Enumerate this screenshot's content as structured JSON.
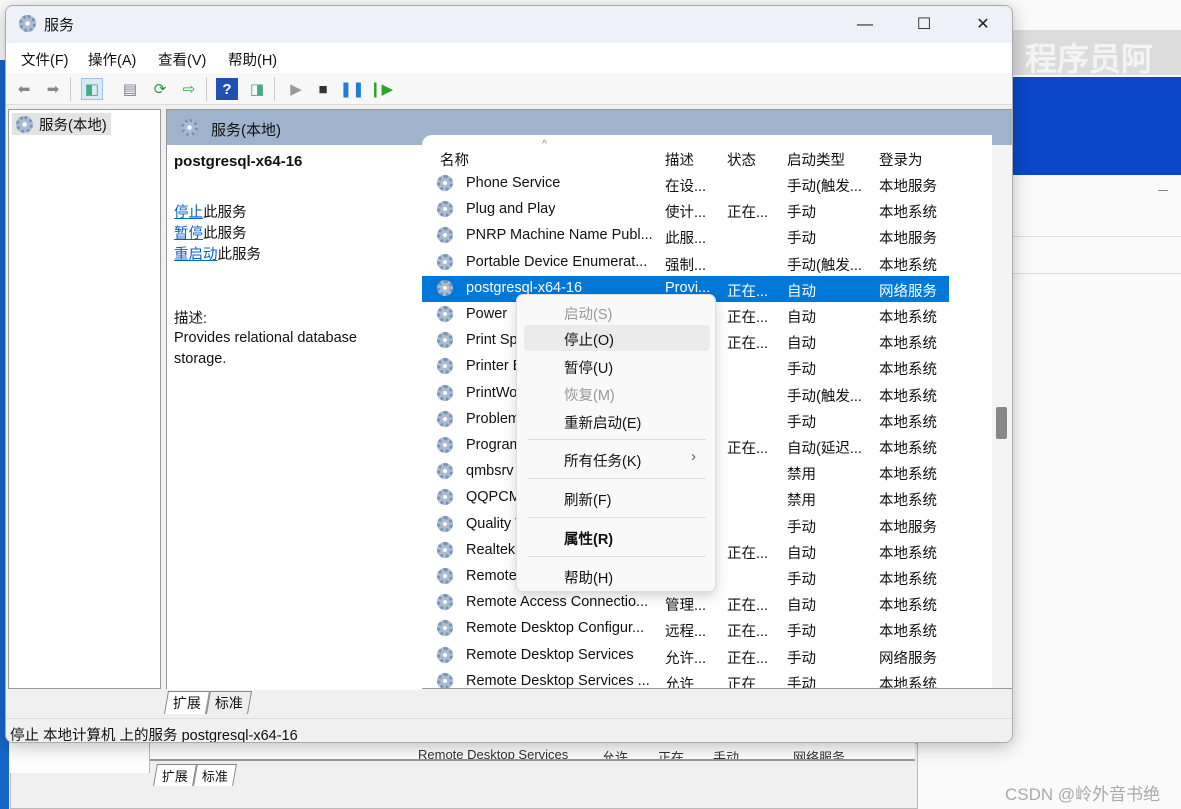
{
  "window": {
    "title": "服务",
    "minimize": "—",
    "maximize": "☐",
    "close": "✕"
  },
  "menubar": [
    "文件(F)",
    "操作(A)",
    "查看(V)",
    "帮助(H)"
  ],
  "toolbar": [
    "back-icon",
    "forward-icon",
    "show-hide-tree-icon",
    "properties-icon",
    "refresh-icon",
    "export-icon",
    "help-icon",
    "action-pane-icon",
    "start-icon",
    "stop-icon",
    "pause-icon",
    "resume-icon"
  ],
  "tree": {
    "root": "服务(本地)"
  },
  "main": {
    "header": "服务(本地)",
    "service_name": "postgresql-x64-16",
    "actions": [
      {
        "link": "停止",
        "suffix": "此服务"
      },
      {
        "link": "暂停",
        "suffix": "此服务"
      },
      {
        "link": "重启动",
        "suffix": "此服务"
      }
    ],
    "description_label": "描述:",
    "description": "Provides relational database storage."
  },
  "columns": [
    "名称",
    "描述",
    "状态",
    "启动类型",
    "登录为"
  ],
  "rows": [
    [
      "Phone Service",
      "在设...",
      "",
      "手动(触发...",
      "本地服务"
    ],
    [
      "Plug and Play",
      "使计...",
      "正在...",
      "手动",
      "本地系统"
    ],
    [
      "PNRP Machine Name Publ...",
      "此服...",
      "",
      "手动",
      "本地服务"
    ],
    [
      "Portable Device Enumerat...",
      "强制...",
      "",
      "手动(触发...",
      "本地系统"
    ],
    [
      "postgresql-x64-16",
      "Provi...",
      "正在...",
      "自动",
      "网络服务"
    ],
    [
      "Power",
      "",
      "正在...",
      "自动",
      "本地系统"
    ],
    [
      "Print Spo",
      "",
      "正在...",
      "自动",
      "本地系统"
    ],
    [
      "Printer E",
      "",
      "",
      "手动",
      "本地系统"
    ],
    [
      "PrintWor",
      "",
      "",
      "手动(触发...",
      "本地系统"
    ],
    [
      "Problem",
      "",
      "",
      "手动",
      "本地系统"
    ],
    [
      "Program",
      "",
      "正在...",
      "自动(延迟...",
      "本地系统"
    ],
    [
      "qmbsrv",
      "",
      "",
      "禁用",
      "本地系统"
    ],
    [
      "QQPCM",
      "",
      "",
      "禁用",
      "本地系统"
    ],
    [
      "Quality V",
      "",
      "",
      "手动",
      "本地服务"
    ],
    [
      "Realtek A",
      "",
      "正在...",
      "自动",
      "本地系统"
    ],
    [
      "Remote",
      "",
      "",
      "手动",
      "本地系统"
    ],
    [
      "Remote Access Connectio...",
      "管理...",
      "正在...",
      "自动",
      "本地系统"
    ],
    [
      "Remote Desktop Configur...",
      "远程...",
      "正在...",
      "手动",
      "本地系统"
    ],
    [
      "Remote Desktop Services",
      "允许...",
      "正在...",
      "手动",
      "网络服务"
    ],
    [
      "Remote Desktop Services ...",
      "允许",
      "正在",
      "手动",
      "本地系统"
    ]
  ],
  "selected_row": 4,
  "tabs": [
    "扩展",
    "标准"
  ],
  "status": "停止 本地计算机 上的服务 postgresql-x64-16",
  "context_menu": [
    {
      "label": "启动(S)",
      "disabled": true
    },
    {
      "label": "停止(O)",
      "hover": true
    },
    {
      "label": "暂停(U)"
    },
    {
      "label": "恢复(M)",
      "disabled": true
    },
    {
      "label": "重新启动(E)"
    },
    {
      "sep": true
    },
    {
      "label": "所有任务(K)",
      "submenu": "›"
    },
    {
      "sep": true
    },
    {
      "label": "刷新(F)"
    },
    {
      "sep": true
    },
    {
      "label": "属性(R)",
      "bold": true
    },
    {
      "sep": true
    },
    {
      "label": "帮助(H)"
    }
  ],
  "background": {
    "banner_text": "程序员阿",
    "row": [
      "Remote Desktop Services",
      "允许",
      "正在",
      "手动",
      "网络服务"
    ],
    "tabs": [
      "扩展",
      "标准"
    ],
    "watermark": "CSDN @岭外音书绝",
    "accent": "#0a47c9"
  }
}
